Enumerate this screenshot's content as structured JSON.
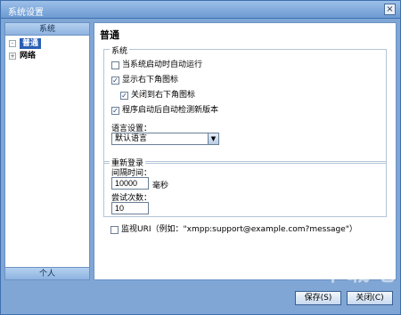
{
  "window": {
    "title": "系统设置",
    "close_symbol": "×"
  },
  "sidebar": {
    "header": "系统",
    "footer": "个人",
    "items": [
      {
        "label": "普通",
        "expander": "-",
        "selected": true
      },
      {
        "label": "网络",
        "expander": "+",
        "selected": false
      }
    ]
  },
  "content": {
    "title": "普通",
    "system_group": {
      "title": "系统",
      "checkboxes": [
        {
          "label": "当系统启动时自动运行",
          "checked": false
        },
        {
          "label": "显示右下角图标",
          "checked": true
        },
        {
          "label": "关闭到右下角图标",
          "checked": true
        },
        {
          "label": "程序启动后自动检测新版本",
          "checked": true
        }
      ],
      "language_label": "语言设置：",
      "language_value": "默认语言"
    },
    "relogin_group": {
      "title": "重新登录",
      "interval_label": "间隔时间：",
      "interval_value": "10000",
      "interval_unit": "毫秒",
      "retry_label": "尝试次数：",
      "retry_value": "10"
    },
    "monitor_uri": {
      "label": "监视URI（例如：\"xmpp:support@example.com?message\"）",
      "checked": false
    }
  },
  "footer": {
    "save_label": "保存(S)",
    "close_label": "关闭(C)"
  },
  "watermark": "下载吧"
}
